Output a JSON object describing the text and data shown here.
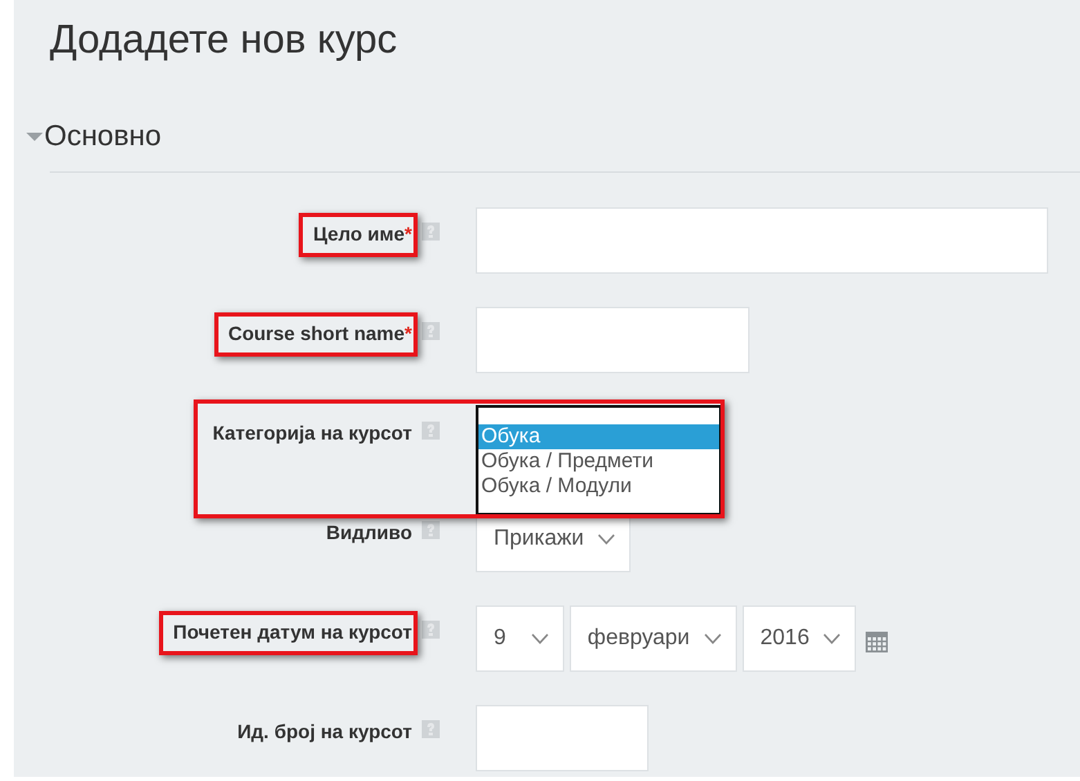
{
  "page_title": "Додадете нов курс",
  "section": {
    "title": "Основно",
    "expanded": true
  },
  "fields": [
    {
      "kind": "wide-text",
      "label": "Цело име",
      "required_mark": "*",
      "highlighted": true
    },
    {
      "kind": "text",
      "label": "Course short name",
      "required_mark": "*",
      "highlighted": true
    },
    {
      "kind": "listbox",
      "label": "Категорија на курсот",
      "highlighted": true,
      "options": [
        {
          "label": "Обука",
          "selected": true
        },
        {
          "label": "Обука / Предмети",
          "selected": false
        },
        {
          "label": "Обука / Модули",
          "selected": false
        }
      ]
    },
    {
      "kind": "select",
      "label": "Видливо",
      "highlighted": false,
      "value": "Прикажи"
    },
    {
      "kind": "date",
      "label": "Почетен датум на курсот",
      "highlighted": true,
      "parts": [
        "9",
        "февруари",
        "2016"
      ]
    },
    {
      "kind": "short-text",
      "label": "Ид. број на курсот",
      "highlighted": false
    }
  ]
}
